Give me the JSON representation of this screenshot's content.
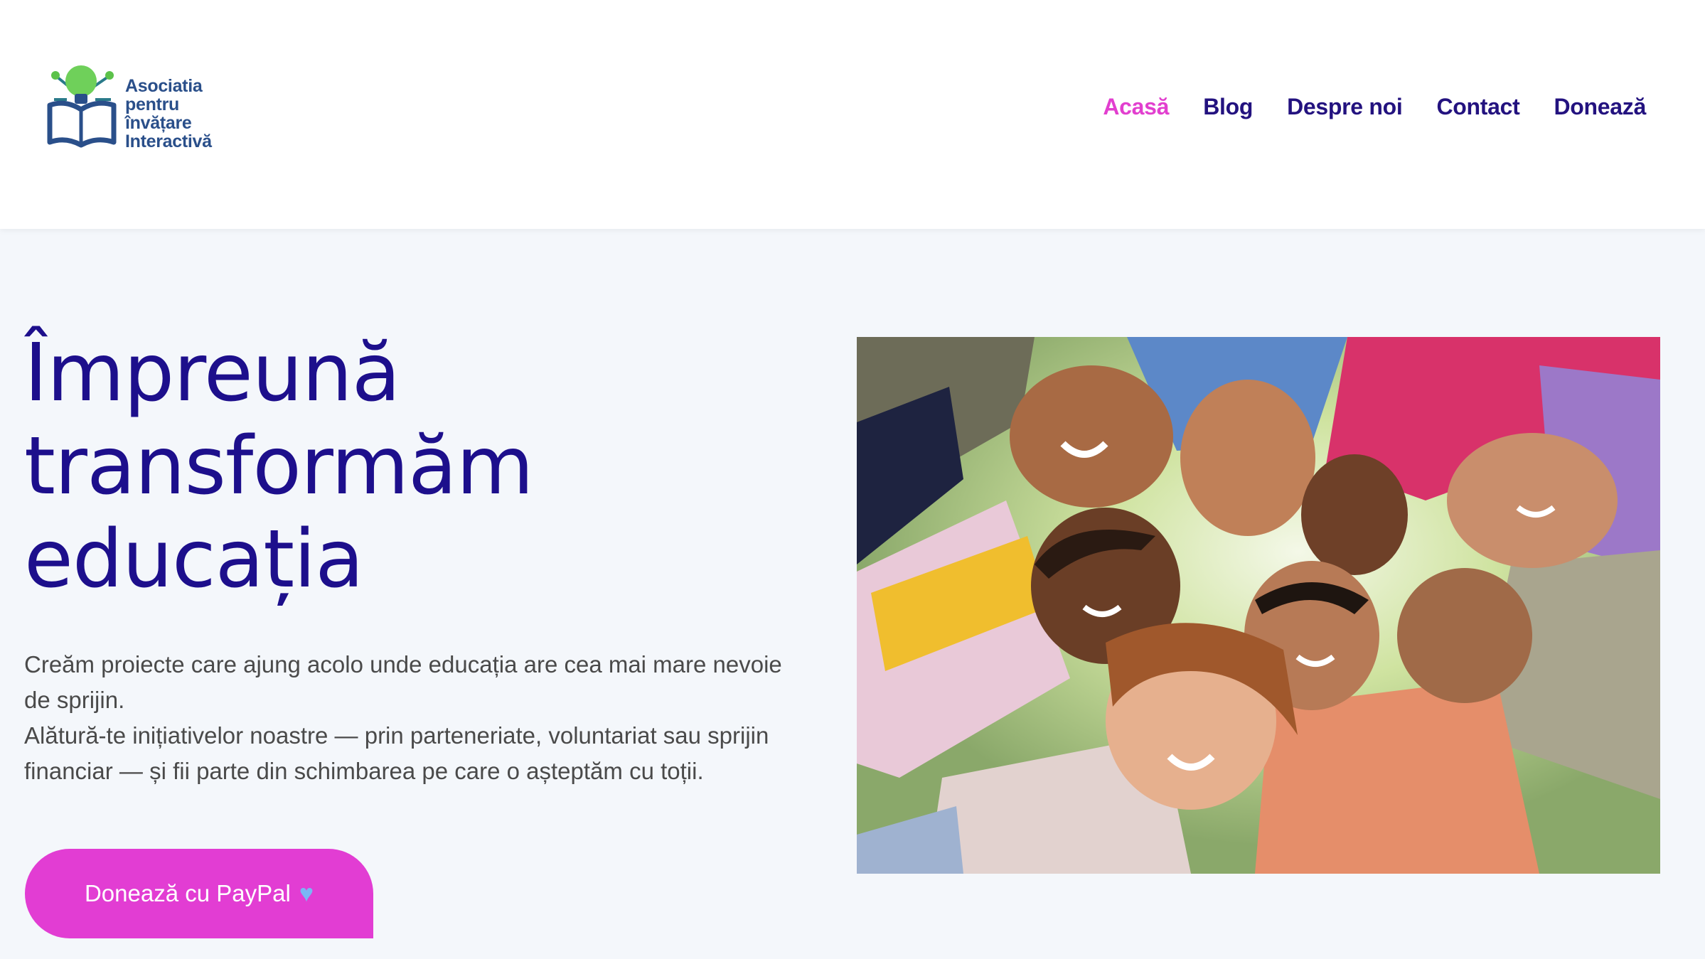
{
  "brand": {
    "logo_lines": [
      "Asociatia",
      "pentru",
      "învățare",
      "Interactivă"
    ],
    "logo_icon": "book-lightbulb-icon",
    "colors": {
      "logo_blue": "#2a4f8a",
      "bulb_green": "#5cc24a"
    }
  },
  "nav": {
    "items": [
      {
        "label": "Acasă",
        "active": true
      },
      {
        "label": "Blog",
        "active": false
      },
      {
        "label": "Despre noi",
        "active": false
      },
      {
        "label": "Contact",
        "active": false
      },
      {
        "label": "Donează",
        "active": false
      }
    ],
    "colors": {
      "link": "#23127f",
      "active": "#e23fcf"
    }
  },
  "hero": {
    "title_lines": [
      "Împreună",
      "transformăm",
      "educația"
    ],
    "paragraphs": [
      "Creăm proiecte care ajung acolo unde educația are cea mai mare nevoie de sprijin.",
      "Alătură-te inițiativelor noastre — prin parteneriate, voluntariat sau sprijin financiar — și fii parte din schimbarea pe care o așteptăm cu toții."
    ],
    "donate_button": {
      "label": "Donează cu PayPal",
      "icon": "heart-icon"
    },
    "image_alt": "Copii zâmbitori în cerc, priviți de jos",
    "colors": {
      "title": "#1d0f8c",
      "button": "#e23dd3"
    }
  }
}
